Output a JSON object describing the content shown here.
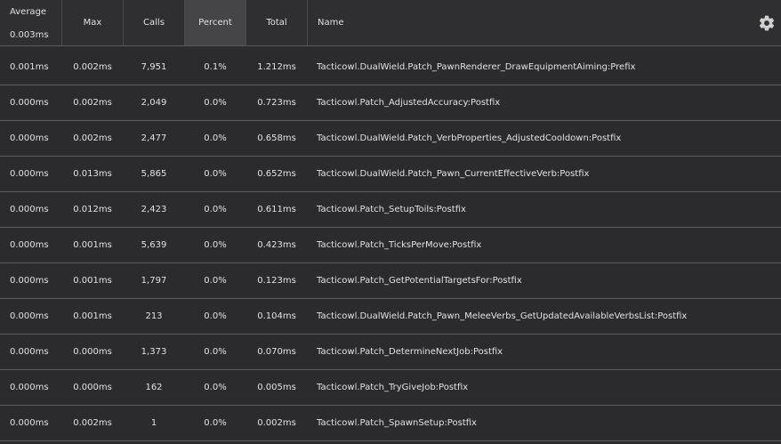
{
  "header": {
    "average_label": "Average",
    "average_value": "0.003ms",
    "max_label": "Max",
    "calls_label": "Calls",
    "percent_label": "Percent",
    "total_label": "Total",
    "name_label": "Name",
    "settings_icon": "gear-icon"
  },
  "colors": {
    "background": "#2c2c2e",
    "sorted_header": "#454547",
    "row_divider": "#5c5c5e",
    "text": "#e2e2e2"
  },
  "rows": [
    {
      "average": "0.001ms",
      "max": "0.002ms",
      "calls": "7,951",
      "percent": "0.1%",
      "total": "1.212ms",
      "name": "Tacticowl.DualWield.Patch_PawnRenderer_DrawEquipmentAiming:Prefix"
    },
    {
      "average": "0.000ms",
      "max": "0.002ms",
      "calls": "2,049",
      "percent": "0.0%",
      "total": "0.723ms",
      "name": "Tacticowl.Patch_AdjustedAccuracy:Postfix"
    },
    {
      "average": "0.000ms",
      "max": "0.002ms",
      "calls": "2,477",
      "percent": "0.0%",
      "total": "0.658ms",
      "name": "Tacticowl.DualWield.Patch_VerbProperties_AdjustedCooldown:Postfix"
    },
    {
      "average": "0.000ms",
      "max": "0.013ms",
      "calls": "5,865",
      "percent": "0.0%",
      "total": "0.652ms",
      "name": "Tacticowl.DualWield.Patch_Pawn_CurrentEffectiveVerb:Postfix"
    },
    {
      "average": "0.000ms",
      "max": "0.012ms",
      "calls": "2,423",
      "percent": "0.0%",
      "total": "0.611ms",
      "name": "Tacticowl.Patch_SetupToils:Postfix"
    },
    {
      "average": "0.000ms",
      "max": "0.001ms",
      "calls": "5,639",
      "percent": "0.0%",
      "total": "0.423ms",
      "name": "Tacticowl.Patch_TicksPerMove:Postfix"
    },
    {
      "average": "0.000ms",
      "max": "0.001ms",
      "calls": "1,797",
      "percent": "0.0%",
      "total": "0.123ms",
      "name": "Tacticowl.Patch_GetPotentialTargetsFor:Postfix"
    },
    {
      "average": "0.000ms",
      "max": "0.001ms",
      "calls": "213",
      "percent": "0.0%",
      "total": "0.104ms",
      "name": "Tacticowl.DualWield.Patch_Pawn_MeleeVerbs_GetUpdatedAvailableVerbsList:Postfix"
    },
    {
      "average": "0.000ms",
      "max": "0.000ms",
      "calls": "1,373",
      "percent": "0.0%",
      "total": "0.070ms",
      "name": "Tacticowl.Patch_DetermineNextJob:Postfix"
    },
    {
      "average": "0.000ms",
      "max": "0.000ms",
      "calls": "162",
      "percent": "0.0%",
      "total": "0.005ms",
      "name": "Tacticowl.Patch_TryGiveJob:Postfix"
    },
    {
      "average": "0.000ms",
      "max": "0.002ms",
      "calls": "1",
      "percent": "0.0%",
      "total": "0.002ms",
      "name": "Tacticowl.Patch_SpawnSetup:Postfix"
    }
  ]
}
